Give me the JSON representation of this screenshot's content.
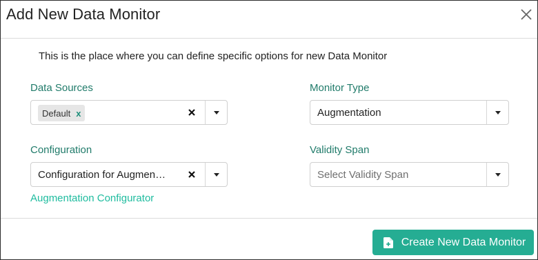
{
  "dialog": {
    "title": "Add New Data Monitor",
    "description": "This is the place where you can define specific options for new Data Monitor"
  },
  "data_sources": {
    "label": "Data Sources",
    "chips": [
      {
        "label": "Default",
        "remove": "x"
      }
    ]
  },
  "monitor_type": {
    "label": "Monitor Type",
    "value": "Augmentation"
  },
  "configuration": {
    "label": "Configuration",
    "value": "Configuration for Augmen…",
    "link": "Augmentation Configurator"
  },
  "validity_span": {
    "label": "Validity Span",
    "placeholder": "Select Validity Span"
  },
  "footer": {
    "create_label": "Create New Data Monitor"
  },
  "colors": {
    "accent": "#25ad93",
    "label_text": "#207b6a",
    "link_text": "#1fbc9f"
  },
  "icons": [
    "close-icon",
    "chip-remove-icon",
    "clear-icon",
    "chevron-down-icon",
    "file-add-icon"
  ]
}
